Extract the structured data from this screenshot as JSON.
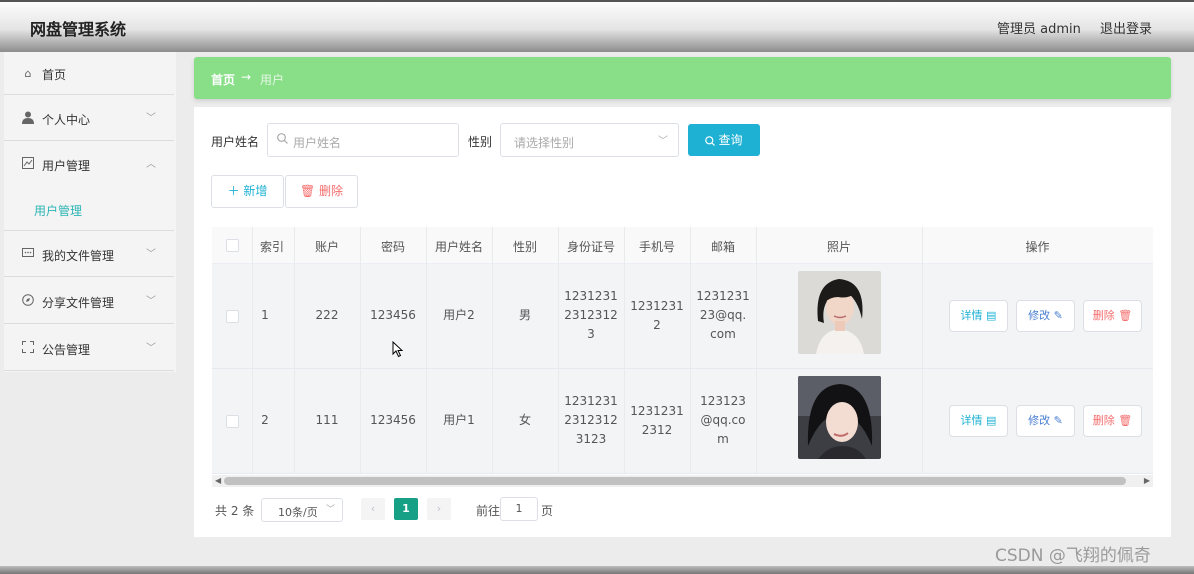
{
  "header": {
    "title": "网盘管理系统",
    "admin": "管理员 admin",
    "logout": "退出登录"
  },
  "sidebar": {
    "items": [
      {
        "label": "首页",
        "icon": "home-icon"
      },
      {
        "label": "个人中心",
        "icon": "user-icon"
      },
      {
        "label": "用户管理",
        "icon": "chart-icon"
      },
      {
        "label": "我的文件管理",
        "icon": "message-icon"
      },
      {
        "label": "分享文件管理",
        "icon": "compass-icon"
      },
      {
        "label": "公告管理",
        "icon": "fullscreen-icon"
      }
    ],
    "active_sub": "用户管理"
  },
  "breadcrumb": {
    "home": "首页",
    "arrow": "→",
    "current": "用户"
  },
  "search": {
    "name_label": "用户姓名",
    "name_placeholder": "用户姓名",
    "gender_label": "性别",
    "gender_placeholder": "请选择性别",
    "query_button": "查询"
  },
  "toolbar": {
    "add": "新增",
    "delete": "删除"
  },
  "table": {
    "headers": [
      "索引",
      "账户",
      "密码",
      "用户姓名",
      "性别",
      "身份证号",
      "手机号",
      "邮箱",
      "照片",
      "操作"
    ],
    "rows": [
      {
        "index": "1",
        "account": "222",
        "password": "123456",
        "name": "用户2",
        "gender": "男",
        "id_lines": [
          "1231231",
          "2312312",
          "3"
        ],
        "phone_lines": [
          "1231231",
          "2"
        ],
        "email_lines": [
          "1231231",
          "23@qq.",
          "com"
        ]
      },
      {
        "index": "2",
        "account": "111",
        "password": "123456",
        "name": "用户1",
        "gender": "女",
        "id_lines": [
          "1231231",
          "2312312",
          "3123"
        ],
        "phone_lines": [
          "1231231",
          "2312"
        ],
        "email_lines": [
          "123123",
          "@qq.co",
          "m"
        ]
      }
    ],
    "actions": {
      "detail": "详情",
      "edit": "修改",
      "delete": "删除"
    }
  },
  "pagination": {
    "total": "共 2 条",
    "page_size": "10条/页",
    "current_page": "1",
    "goto_label": "前往",
    "goto_value": "1",
    "page_unit": "页"
  },
  "watermark": "CSDN @飞翔的佩奇",
  "colors": {
    "accent": "#1eb1d4",
    "breadcrumb": "#88df88",
    "page_active": "#16a085",
    "danger": "#f56c6c",
    "teal": "#2cb5b4"
  }
}
